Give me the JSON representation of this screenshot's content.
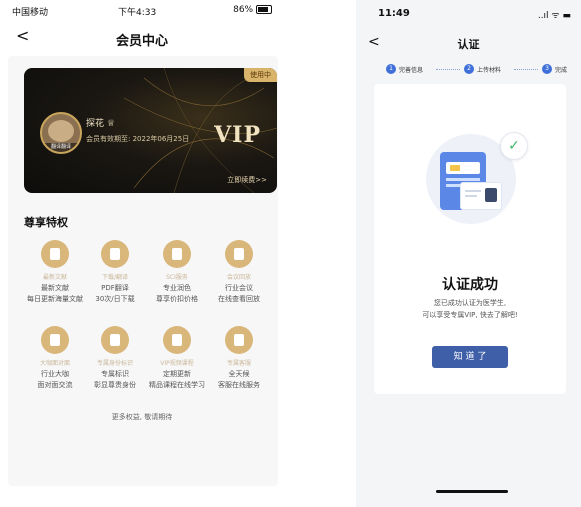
{
  "left": {
    "status": {
      "carrier": "中国移动",
      "time": "下午4:33",
      "battery": "86%"
    },
    "nav": {
      "back": "<",
      "title": "会员中心"
    },
    "vip_card": {
      "tag": "使用中",
      "avatar_caption": "翻译翻译",
      "username": "探花",
      "expiry": "会员有效期至: 2022年06月25日",
      "vip_label": "VIP",
      "renew": "立即续费>>"
    },
    "privileges_title": "尊享特权",
    "privileges": [
      {
        "name": "最新文献",
        "line1": "最新文献",
        "line2": "每日更新海量文献"
      },
      {
        "name": "下载/翻译",
        "line1": "PDF翻译",
        "line2": "30次/日下载"
      },
      {
        "name": "SCI服务",
        "line1": "专业润色",
        "line2": "尊享价扣价格"
      },
      {
        "name": "会议回放",
        "line1": "行业会议",
        "line2": "在线查看回放"
      },
      {
        "name": "大咖面对面",
        "line1": "行业大咖",
        "line2": "面对面交流"
      },
      {
        "name": "专属身份标识",
        "line1": "专属标识",
        "line2": "彰显尊贵身份"
      },
      {
        "name": "VIP视频课程",
        "line1": "定期更新",
        "line2": "精品课程在线学习"
      },
      {
        "name": "专属客服",
        "line1": "全天候",
        "line2": "客服在线服务"
      }
    ],
    "more": "更多权益, 敬请期待"
  },
  "right": {
    "status": {
      "time": "11:49",
      "icons": "..ıl ᯤ ▬"
    },
    "nav": {
      "back": "<",
      "title": "认证"
    },
    "steps": [
      {
        "num": "1",
        "label": "完善信息"
      },
      {
        "num": "2",
        "label": "上传材料"
      },
      {
        "num": "3",
        "label": "完成"
      }
    ],
    "success_title": "认证成功",
    "success_desc1": "您已成功认证为医学生,",
    "success_desc2": "可以享受专属VIP, 快去了解吧!",
    "button": "知 道 了"
  },
  "colors": {
    "gold": "#d9b679",
    "blue": "#3f6fd8",
    "button": "#3f5fa8",
    "check": "#3fb86a"
  }
}
